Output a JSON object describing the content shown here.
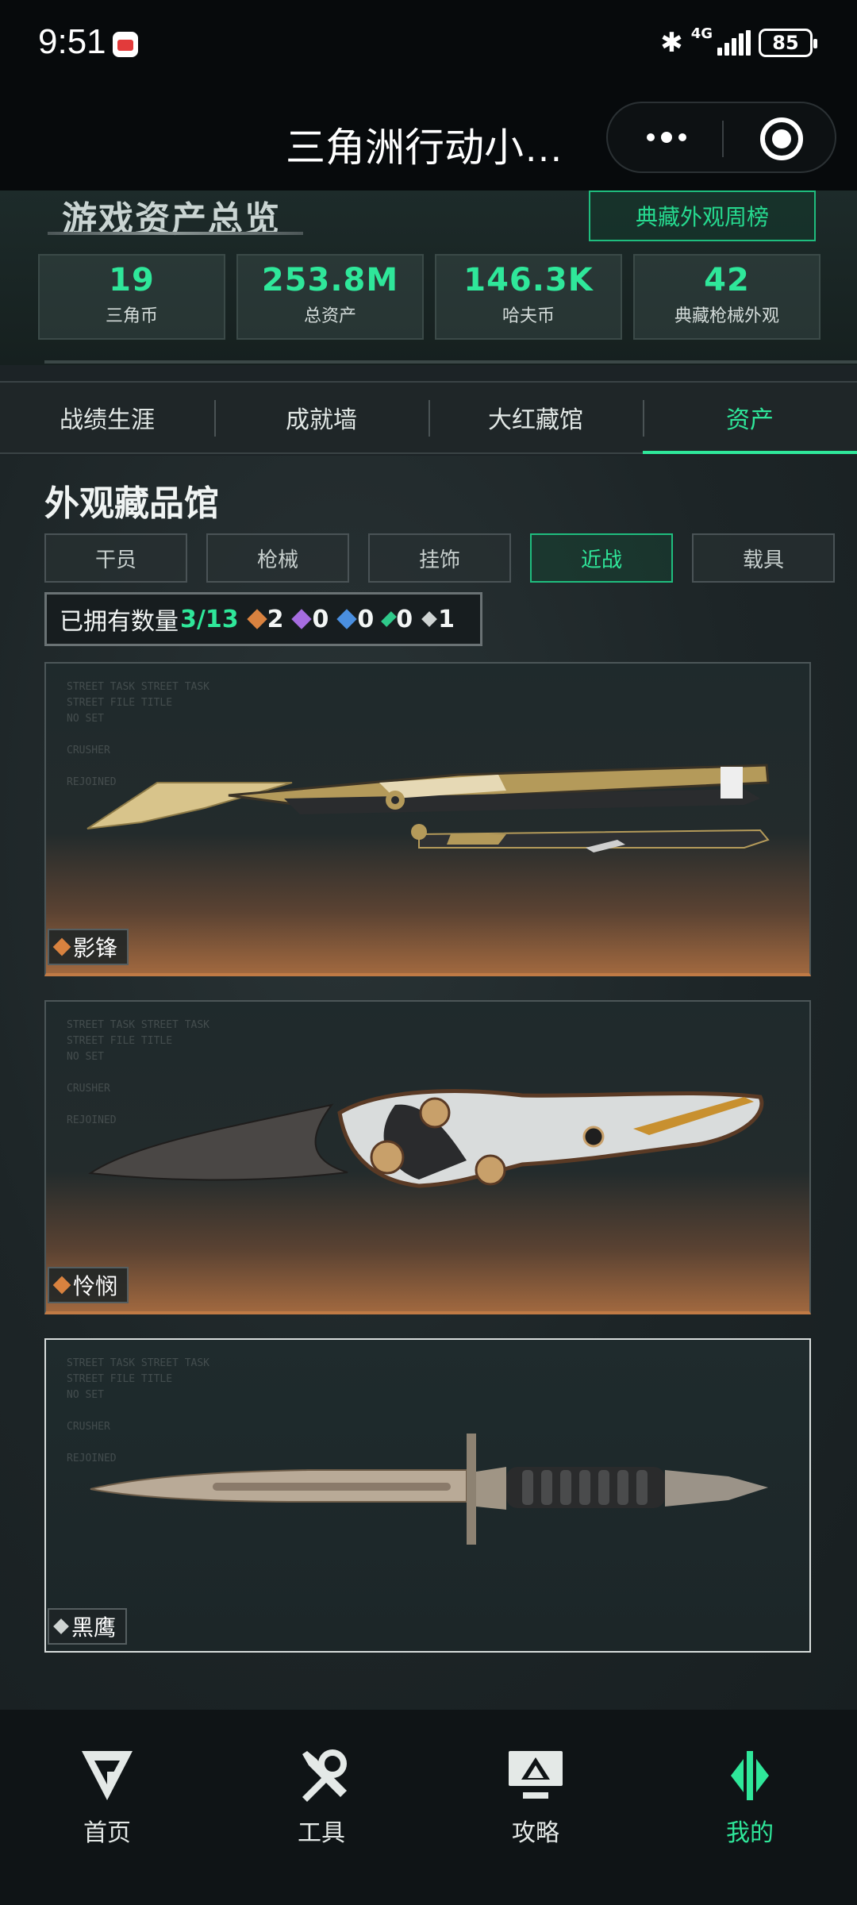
{
  "status_bar": {
    "time": "9:51",
    "network": "4G",
    "battery": "85"
  },
  "header": {
    "title": "三角洲行动小…"
  },
  "summary": {
    "title": "游戏资产总览",
    "weekly_button": "典藏外观周榜",
    "stats": [
      {
        "value": "19",
        "label": "三角币"
      },
      {
        "value": "253.8M",
        "label": "总资产"
      },
      {
        "value": "146.3K",
        "label": "哈夫币"
      },
      {
        "value": "42",
        "label": "典藏枪械外观"
      }
    ]
  },
  "tabs": [
    {
      "label": "战绩生涯",
      "active": false
    },
    {
      "label": "成就墙",
      "active": false
    },
    {
      "label": "大红藏馆",
      "active": false
    },
    {
      "label": "资产",
      "active": true
    }
  ],
  "collection": {
    "title": "外观藏品馆",
    "filters": [
      {
        "label": "干员",
        "active": false
      },
      {
        "label": "枪械",
        "active": false
      },
      {
        "label": "挂饰",
        "active": false
      },
      {
        "label": "近战",
        "active": true
      },
      {
        "label": "载具",
        "active": false
      }
    ],
    "owned_label": "已拥有数量",
    "owned_count": "3/13",
    "rarity_counts": [
      {
        "icon": "orange-diamond-icon",
        "color": "#d9823f",
        "count": "2"
      },
      {
        "icon": "purple-diamond-icon",
        "color": "#a66de0",
        "count": "0"
      },
      {
        "icon": "blue-diamond-icon",
        "color": "#4a8fe0",
        "count": "0"
      },
      {
        "icon": "green-diamond-icon",
        "color": "#2fc98a",
        "count": "0"
      },
      {
        "icon": "white-diamond-icon",
        "color": "#cfd4d3",
        "count": "1"
      }
    ],
    "items": [
      {
        "name": "影锋",
        "rarity": "orange"
      },
      {
        "name": "怜悯",
        "rarity": "orange"
      },
      {
        "name": "黑鹰",
        "rarity": "white"
      }
    ]
  },
  "bottom_nav": [
    {
      "label": "首页",
      "icon": "home-logo-icon",
      "active": false
    },
    {
      "label": "工具",
      "icon": "tools-icon",
      "active": false
    },
    {
      "label": "攻略",
      "icon": "guide-monitor-icon",
      "active": false
    },
    {
      "label": "我的",
      "icon": "profile-logo-icon",
      "active": true
    }
  ],
  "colors": {
    "accent": "#2fe79a",
    "orange_rarity": "#c07a45"
  }
}
